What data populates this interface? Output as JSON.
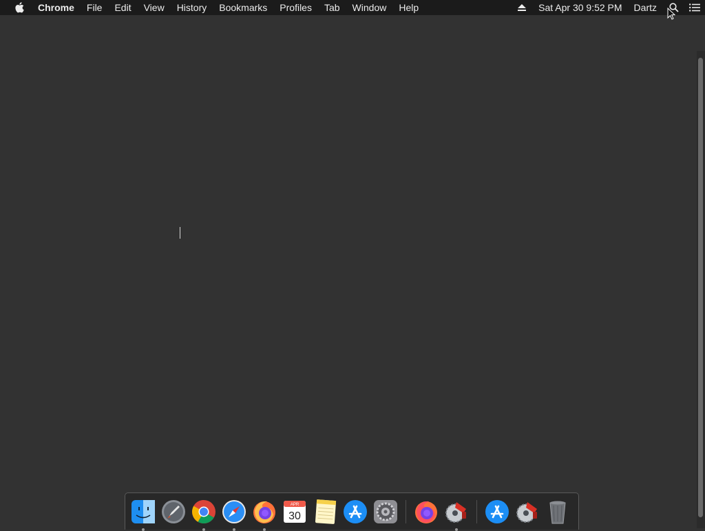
{
  "menubar": {
    "apple_icon": "apple-logo-icon",
    "app_name": "Chrome",
    "menus": [
      "File",
      "Edit",
      "View",
      "History",
      "Bookmarks",
      "Profiles",
      "Tab",
      "Window",
      "Help"
    ],
    "status": {
      "eject_icon": "eject-icon",
      "datetime": "Sat Apr 30  9:52 PM",
      "user": "Dartz",
      "search_icon": "spotlight-search-icon",
      "notification_icon": "notification-center-icon"
    }
  },
  "desktop": {
    "background_color": "#323232",
    "menubar_color": "#1b1b1b"
  },
  "dock": {
    "items": [
      {
        "name": "Finder",
        "icon": "finder-icon",
        "running": true
      },
      {
        "name": "Launchpad",
        "icon": "launchpad-icon",
        "running": false
      },
      {
        "name": "Google Chrome",
        "icon": "chrome-icon",
        "running": true
      },
      {
        "name": "Safari",
        "icon": "safari-icon",
        "running": true
      },
      {
        "name": "Firefox",
        "icon": "firefox-icon",
        "running": true
      },
      {
        "name": "Calendar",
        "icon": "calendar-icon",
        "running": false,
        "month": "APR",
        "day": "30"
      },
      {
        "name": "Notes",
        "icon": "notes-icon",
        "running": false
      },
      {
        "name": "App Store",
        "icon": "app-store-icon",
        "running": false
      },
      {
        "name": "System Preferences",
        "icon": "system-preferences-icon",
        "running": false
      },
      {
        "name": "Firefox",
        "icon": "firefox-icon",
        "running": false
      },
      {
        "name": "Utility App",
        "icon": "saw-blade-app-icon",
        "running": true
      },
      {
        "name": "App Store",
        "icon": "app-store-icon",
        "running": false
      },
      {
        "name": "Utility App",
        "icon": "saw-blade-app-icon",
        "running": false
      },
      {
        "name": "Trash",
        "icon": "trash-icon",
        "running": false
      }
    ]
  }
}
